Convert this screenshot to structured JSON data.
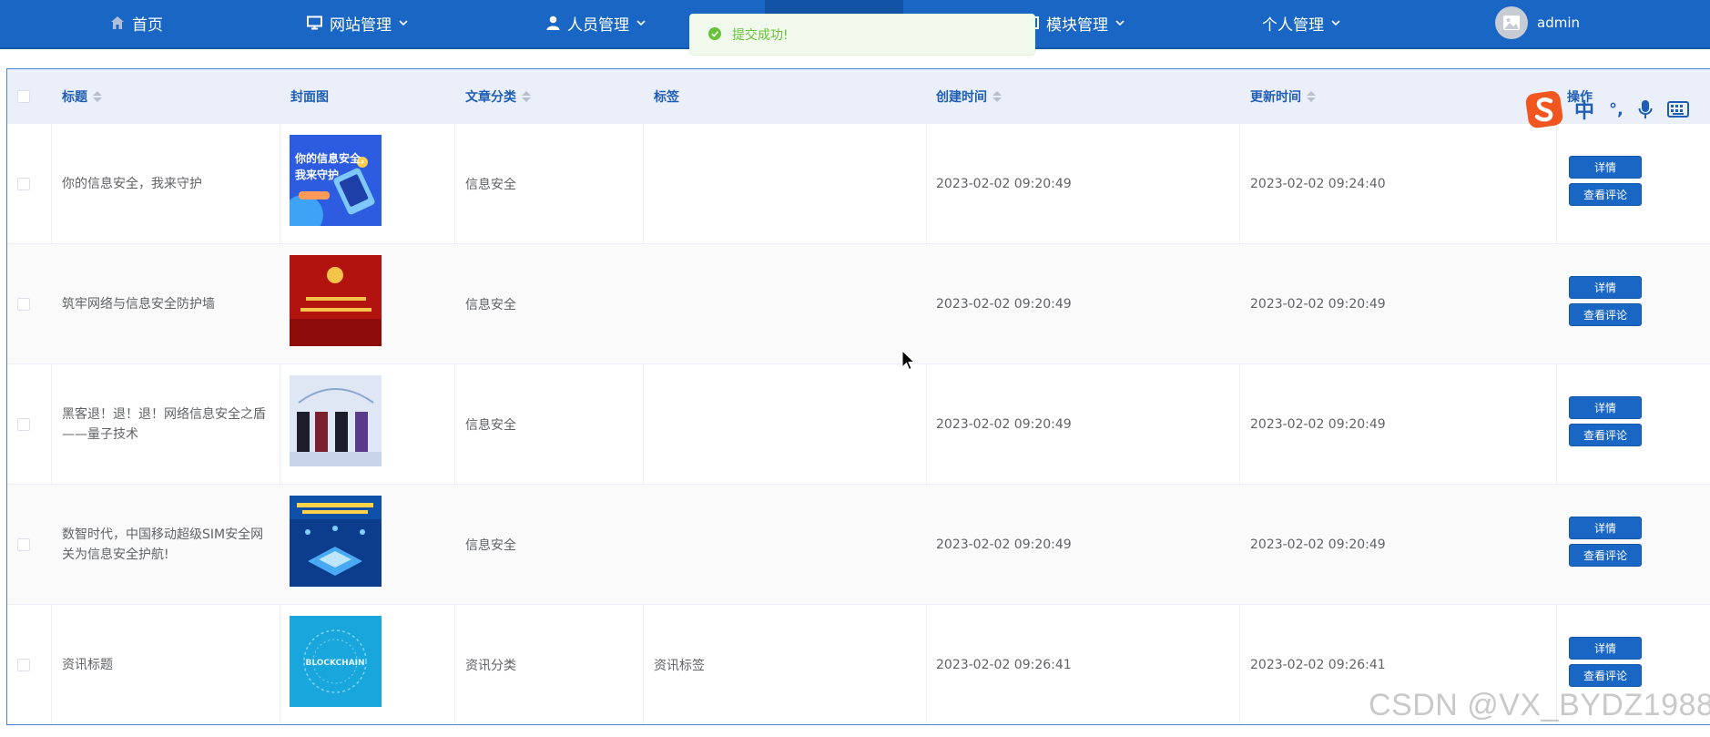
{
  "nav": {
    "home": "首页",
    "site_management": "网站管理",
    "people_management": "人员管理",
    "module_management": "模块管理",
    "personal_management": "个人管理",
    "username": "admin"
  },
  "toast": {
    "message": "提交成功!",
    "color": "#67c23a"
  },
  "table": {
    "columns": [
      "标题",
      "封面图",
      "文章分类",
      "标签",
      "创建时间",
      "更新时间",
      "操作"
    ],
    "rows": [
      {
        "title": "你的信息安全，我来守护",
        "cover_theme": "blue-security",
        "category": "信息安全",
        "tag": "",
        "created": "2023-02-02 09:20:49",
        "updated": "2023-02-02 09:24:40"
      },
      {
        "title": "筑牢网络与信息安全防护墙",
        "cover_theme": "red-banner",
        "category": "信息安全",
        "tag": "",
        "created": "2023-02-02 09:20:49",
        "updated": "2023-02-02 09:20:49"
      },
      {
        "title": "黑客退！退！退！网络信息安全之盾——量子技术",
        "cover_theme": "hackers",
        "category": "信息安全",
        "tag": "",
        "created": "2023-02-02 09:20:49",
        "updated": "2023-02-02 09:20:49"
      },
      {
        "title": "数智时代，中国移动超级SIM安全网关为信息安全护航!",
        "cover_theme": "sim-gateway",
        "category": "信息安全",
        "tag": "",
        "created": "2023-02-02 09:20:49",
        "updated": "2023-02-02 09:20:49"
      },
      {
        "title": "资讯标题",
        "cover_theme": "blockchain",
        "category": "资讯分类",
        "tag": "资讯标签",
        "created": "2023-02-02 09:26:41",
        "updated": "2023-02-02 09:26:41"
      }
    ],
    "actions": {
      "detail": "详情",
      "comments": "查看评论"
    }
  },
  "covers": {
    "c1": {
      "headline": "你的信息安全，我来守护"
    },
    "c5": {
      "text": "BLOCKCHAIN"
    }
  },
  "ime": {
    "lang": "中",
    "punct": "°,"
  },
  "watermark": "CSDN @VX_BYDZ1988",
  "colors": {
    "nav_bg": "#1a66c4",
    "header_bg": "#ebeff9",
    "accent": "#1f5eb5",
    "success": "#67c23a"
  }
}
